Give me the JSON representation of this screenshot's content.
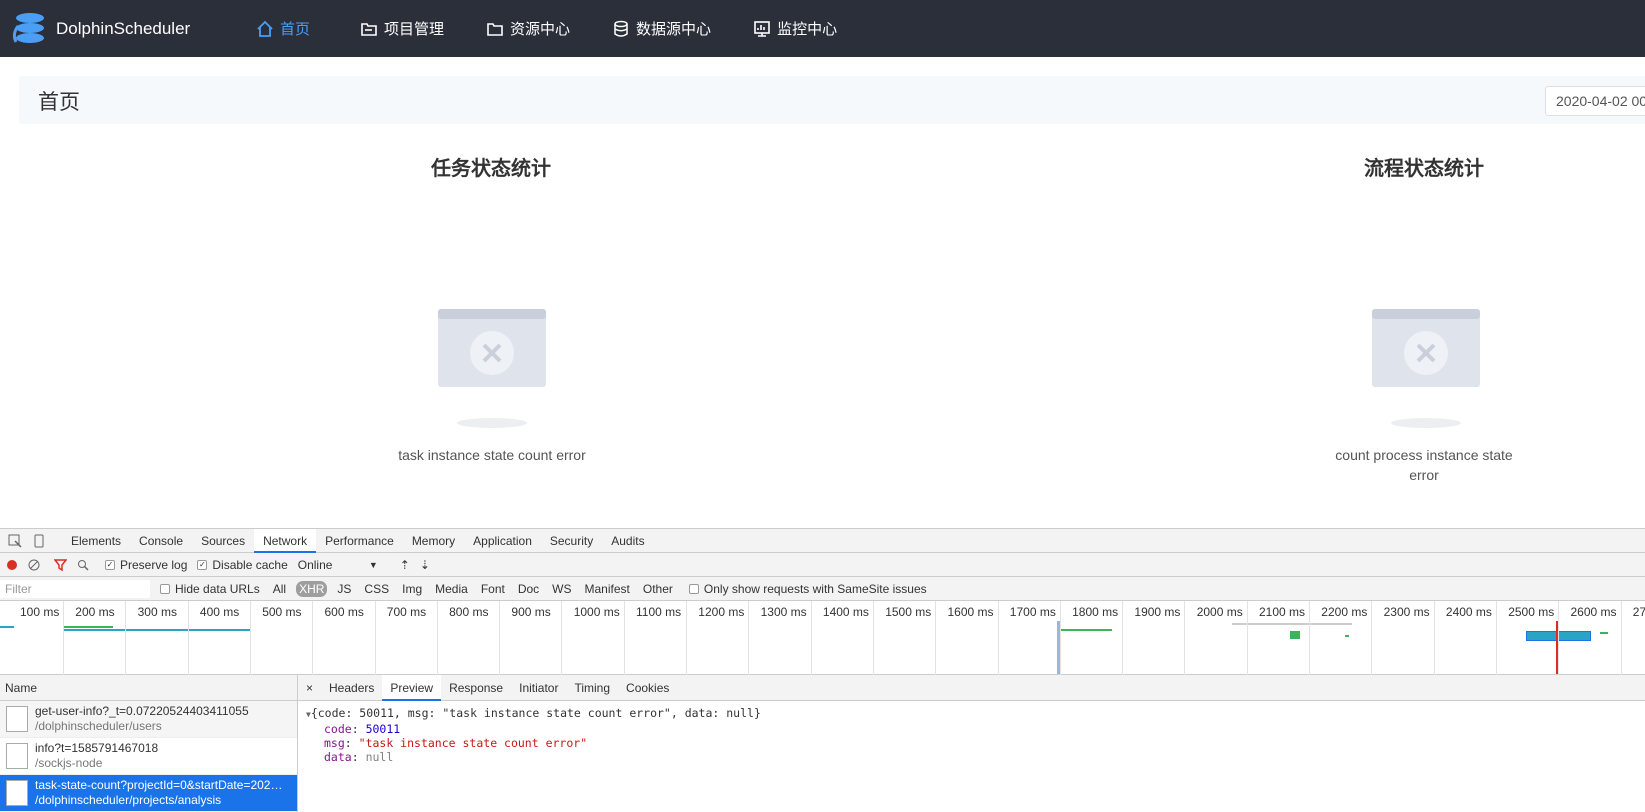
{
  "app": {
    "name": "DolphinScheduler"
  },
  "nav": [
    {
      "label": "首页",
      "icon": "home-icon",
      "active": true
    },
    {
      "label": "项目管理",
      "icon": "project-icon"
    },
    {
      "label": "资源中心",
      "icon": "folder-icon"
    },
    {
      "label": "数据源中心",
      "icon": "database-icon"
    },
    {
      "label": "监控中心",
      "icon": "monitor-icon"
    }
  ],
  "page": {
    "title": "首页",
    "date_value": "2020-04-02 00"
  },
  "task_stats": {
    "title": "任务状态统计",
    "error": "task instance state count error"
  },
  "process_stats": {
    "title": "流程状态统计",
    "error": "count process instance state error"
  },
  "devtools": {
    "tabs": [
      "Elements",
      "Console",
      "Sources",
      "Network",
      "Performance",
      "Memory",
      "Application",
      "Security",
      "Audits"
    ],
    "active_tab": "Network",
    "toolbar": {
      "preserve_log": "Preserve log",
      "disable_cache": "Disable cache",
      "throttle": "Online"
    },
    "filter": {
      "placeholder": "Filter",
      "hide_data_urls": "Hide data URLs",
      "types": [
        "All",
        "XHR",
        "JS",
        "CSS",
        "Img",
        "Media",
        "Font",
        "Doc",
        "WS",
        "Manifest",
        "Other"
      ],
      "active_type": "XHR",
      "samesite": "Only show requests with SameSite issues"
    },
    "timeline_ticks": [
      "100 ms",
      "200 ms",
      "300 ms",
      "400 ms",
      "500 ms",
      "600 ms",
      "700 ms",
      "800 ms",
      "900 ms",
      "1000 ms",
      "1100 ms",
      "1200 ms",
      "1300 ms",
      "1400 ms",
      "1500 ms",
      "1600 ms",
      "1700 ms",
      "1800 ms",
      "1900 ms",
      "2000 ms",
      "2100 ms",
      "2200 ms",
      "2300 ms",
      "2400 ms",
      "2500 ms",
      "2600 ms",
      "27"
    ],
    "name_header": "Name",
    "requests": [
      {
        "name": "get-user-info?_t=0.07220524403411055",
        "path": "/dolphinscheduler/users"
      },
      {
        "name": "info?t=1585791467018",
        "path": "/sockjs-node"
      },
      {
        "name": "task-state-count?projectId=0&startDate=202…",
        "path": "/dolphinscheduler/projects/analysis"
      }
    ],
    "detail_close": "×",
    "detail_tabs": [
      "Headers",
      "Preview",
      "Response",
      "Initiator",
      "Timing",
      "Cookies"
    ],
    "detail_active": "Preview",
    "preview": {
      "summary": "{code: 50011, msg: \"task instance state count error\", data: null}",
      "code_key": "code",
      "code_val": "50011",
      "msg_key": "msg",
      "msg_val": "\"task instance state count error\"",
      "data_key": "data",
      "data_val": "null"
    }
  }
}
